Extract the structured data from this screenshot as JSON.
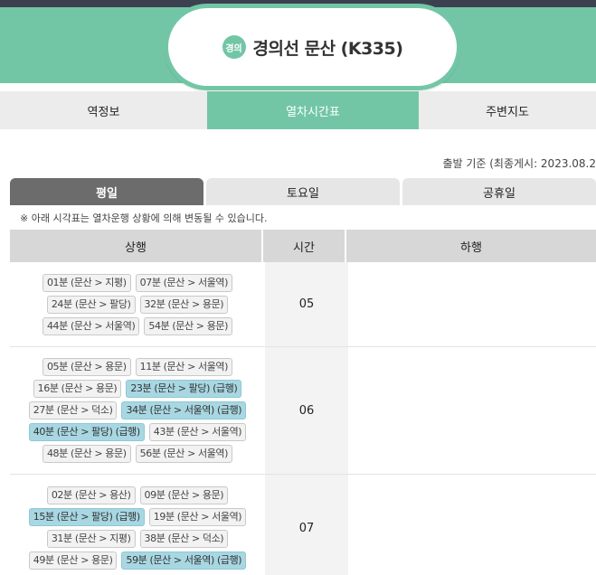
{
  "station": {
    "line_badge": "경의",
    "title": "경의선 문산 (K335)"
  },
  "main_tabs": [
    {
      "label": "역정보",
      "active": false
    },
    {
      "label": "열차시간표",
      "active": true
    },
    {
      "label": "주변지도",
      "active": false
    }
  ],
  "basis_text": "출발 기준 (최종게시: 2023.08.2",
  "day_tabs": [
    {
      "label": "평일",
      "active": true
    },
    {
      "label": "토요일",
      "active": false
    },
    {
      "label": "공휴일",
      "active": false
    }
  ],
  "notice": "※ 아래 시각표는 열차운행 상황에 의해 변동될 수 있습니다.",
  "table": {
    "headers": {
      "up": "상행",
      "time": "시간",
      "down": "하행"
    },
    "rows": [
      {
        "hour": "05",
        "up": [
          [
            {
              "text": "01분 (문산 > 지평)",
              "express": false
            },
            {
              "text": "07분 (문산 > 서울역)",
              "express": false
            }
          ],
          [
            {
              "text": "24분 (문산 > 팔당)",
              "express": false
            },
            {
              "text": "32분 (문산 > 용문)",
              "express": false
            }
          ],
          [
            {
              "text": "44분 (문산 > 서울역)",
              "express": false
            },
            {
              "text": "54분 (문산 > 용문)",
              "express": false
            }
          ]
        ]
      },
      {
        "hour": "06",
        "up": [
          [
            {
              "text": "05분 (문산 > 용문)",
              "express": false
            },
            {
              "text": "11분 (문산 > 서울역)",
              "express": false
            }
          ],
          [
            {
              "text": "16분 (문산 > 용문)",
              "express": false
            },
            {
              "text": "23분 (문산 > 팔당) (급행)",
              "express": true
            }
          ],
          [
            {
              "text": "27분 (문산 > 덕소)",
              "express": false
            },
            {
              "text": "34분 (문산 > 서울역) (급행)",
              "express": true
            }
          ],
          [
            {
              "text": "40분 (문산 > 팔당) (급행)",
              "express": true
            },
            {
              "text": "43분 (문산 > 서울역)",
              "express": false
            }
          ],
          [
            {
              "text": "48분 (문산 > 용문)",
              "express": false
            },
            {
              "text": "56분 (문산 > 서울역)",
              "express": false
            }
          ]
        ]
      },
      {
        "hour": "07",
        "up": [
          [
            {
              "text": "02분 (문산 > 용산)",
              "express": false
            },
            {
              "text": "09분 (문산 > 용문)",
              "express": false
            }
          ],
          [
            {
              "text": "15분 (문산 > 팔당) (급행)",
              "express": true
            },
            {
              "text": "19분 (문산 > 서울역)",
              "express": false
            }
          ],
          [
            {
              "text": "31분 (문산 > 지평)",
              "express": false
            },
            {
              "text": "38분 (문산 > 덕소)",
              "express": false
            }
          ],
          [
            {
              "text": "49분 (문산 > 용문)",
              "express": false
            },
            {
              "text": "59분 (문산 > 서울역) (급행)",
              "express": true
            }
          ]
        ]
      }
    ]
  }
}
